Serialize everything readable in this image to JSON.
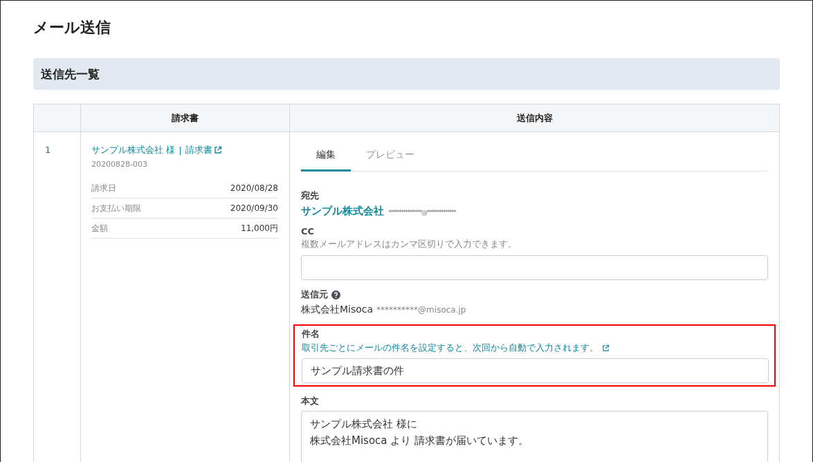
{
  "page_title": "メール送信",
  "section_title": "送信先一覧",
  "table": {
    "columns": [
      "",
      "請求書",
      "送信内容"
    ],
    "rows": [
      {
        "number": "1",
        "client_link": "サンプル株式会社 様",
        "separator": "|",
        "invoice_link": "請求書",
        "invoice_number": "20200828-003",
        "details": [
          {
            "label": "請求日",
            "value": "2020/08/28"
          },
          {
            "label": "お支払い期限",
            "value": "2020/09/30"
          },
          {
            "label": "金額",
            "value": "11,000円"
          }
        ],
        "tabs": [
          {
            "label": "編集",
            "selected": true
          },
          {
            "label": "プレビュー",
            "selected": false
          }
        ],
        "to": {
          "label": "宛先",
          "name": "サンプル株式会社",
          "email": "****************@**************"
        },
        "cc": {
          "label": "CC",
          "hint": "複数メールアドレスはカンマ区切りで入力できます。"
        },
        "from": {
          "label": "送信元",
          "name": "株式会社Misoca",
          "email": "**********@misoca.jp"
        },
        "subject": {
          "label": "件名",
          "hint_link": "取引先ごとにメールの件名を設定すると、次回から自動で入力されます。",
          "value": "サンプル請求書の件",
          "highlighted": true
        },
        "body": {
          "label": "本文",
          "lines": [
            "サンプル株式会社 様に",
            "株式会社Misoca より 請求書が届いています。"
          ]
        }
      }
    ]
  }
}
